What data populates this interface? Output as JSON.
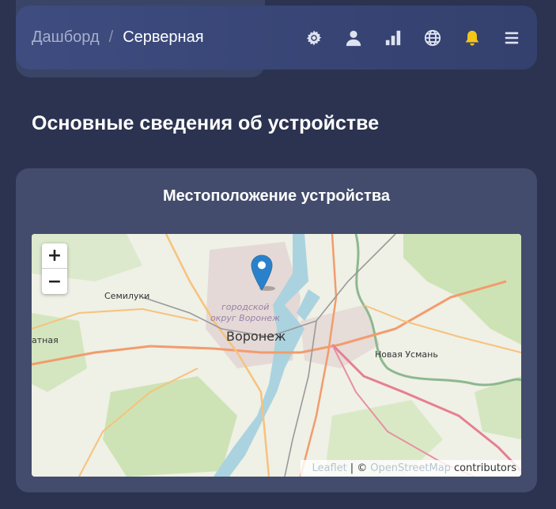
{
  "breadcrumb": {
    "root": "Дашборд",
    "separator": "/",
    "current": "Серверная"
  },
  "header_icons": [
    "gear-icon",
    "user-icon",
    "signal-bars-icon",
    "globe-icon",
    "bell-icon",
    "menu-icon"
  ],
  "colors": {
    "bell": "#f5c518",
    "icon": "#dfe3f0",
    "marker": "#2a81cb"
  },
  "page": {
    "title": "Основные сведения об устройстве"
  },
  "card": {
    "title": "Местоположение устройства"
  },
  "map": {
    "zoom_in": "+",
    "zoom_out": "−",
    "labels": {
      "city": "Воронеж",
      "district_line1": "городской",
      "district_line2": "округ Воронеж",
      "semiluki": "Семилуки",
      "novaya_usman": "Новая Усмань",
      "left_edge": "атная"
    },
    "attribution": {
      "leaflet": "Leaflet",
      "sep": "| ©",
      "osm": "OpenStreetMap",
      "contributors": "contributors"
    }
  }
}
